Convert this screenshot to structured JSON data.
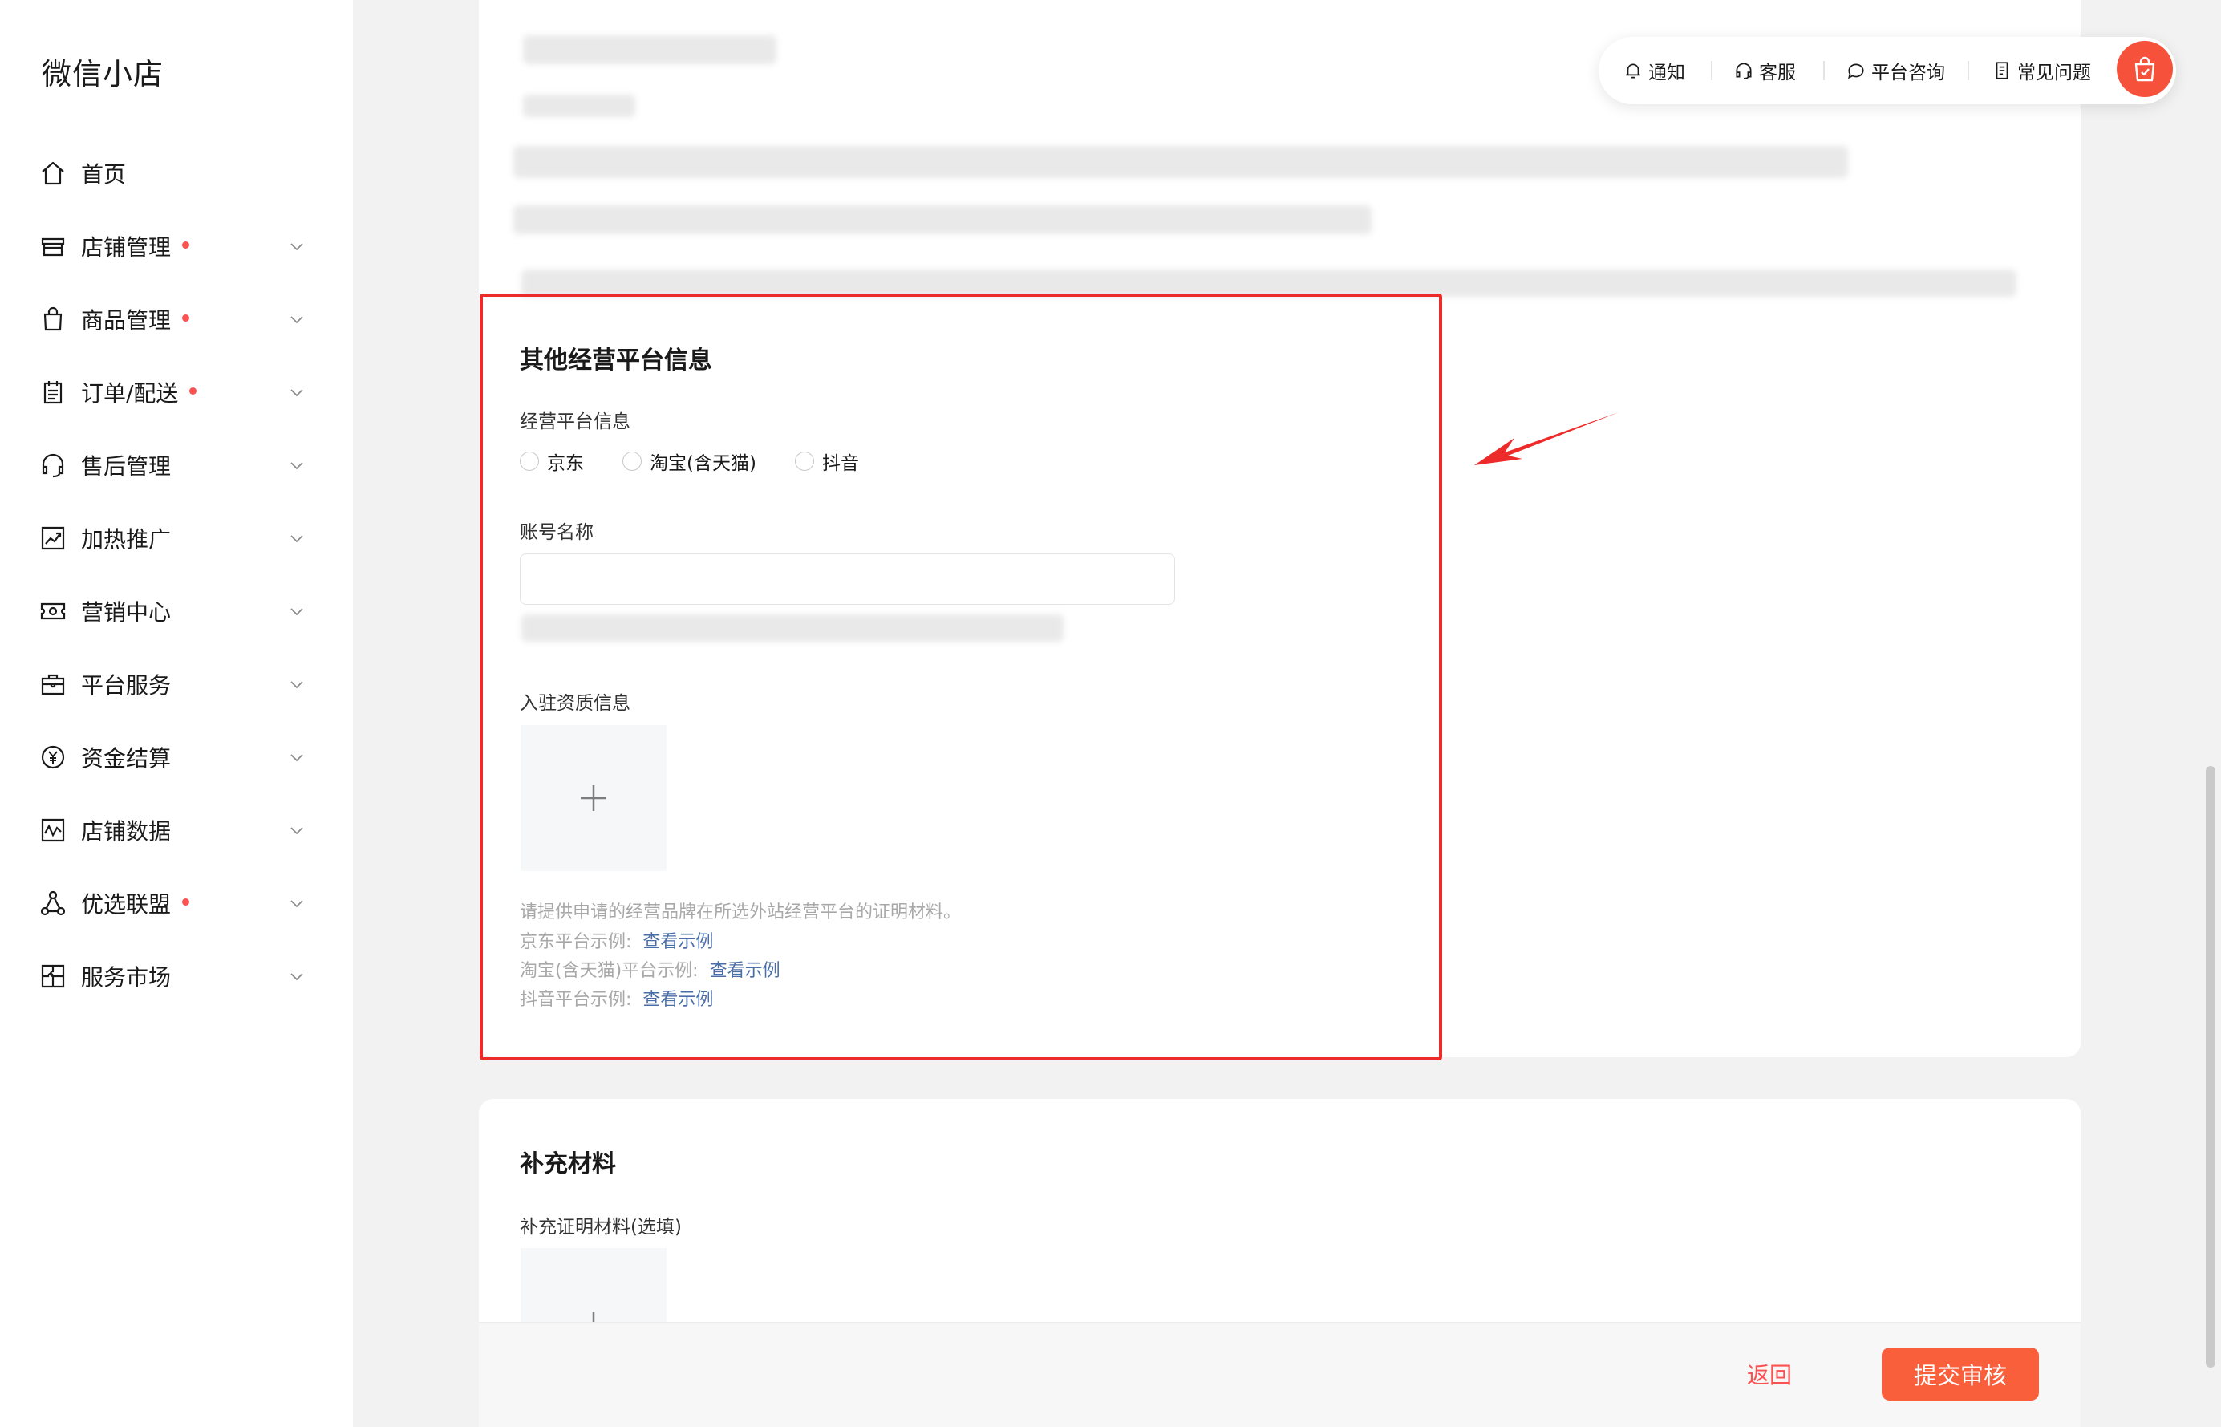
{
  "app": {
    "title": "微信小店"
  },
  "sidebar": {
    "items": [
      {
        "label": "首页",
        "icon": "home-icon",
        "dot": false,
        "chevron": false
      },
      {
        "label": "店铺管理",
        "icon": "store-icon",
        "dot": true,
        "chevron": true
      },
      {
        "label": "商品管理",
        "icon": "shopping-bag-icon",
        "dot": true,
        "chevron": true
      },
      {
        "label": "订单/配送",
        "icon": "order-clipboard-icon",
        "dot": true,
        "chevron": true
      },
      {
        "label": "售后管理",
        "icon": "headset-icon",
        "dot": false,
        "chevron": true
      },
      {
        "label": "加热推广",
        "icon": "trend-chart-icon",
        "dot": false,
        "chevron": true
      },
      {
        "label": "营销中心",
        "icon": "coupon-icon",
        "dot": false,
        "chevron": true
      },
      {
        "label": "平台服务",
        "icon": "briefcase-icon",
        "dot": false,
        "chevron": true
      },
      {
        "label": "资金结算",
        "icon": "yuan-coin-icon",
        "dot": false,
        "chevron": true
      },
      {
        "label": "店铺数据",
        "icon": "data-chart-icon",
        "dot": false,
        "chevron": true
      },
      {
        "label": "优选联盟",
        "icon": "network-icon",
        "dot": true,
        "chevron": true
      },
      {
        "label": "服务市场",
        "icon": "puzzle-icon",
        "dot": false,
        "chevron": true
      }
    ]
  },
  "toolbar": {
    "notify": "通知",
    "service": "客服",
    "consult": "平台咨询",
    "faq": "常见问题"
  },
  "other_platform": {
    "title": "其他经营平台信息",
    "platform_label": "经营平台信息",
    "options": [
      "京东",
      "淘宝(含天猫)",
      "抖音"
    ],
    "account_label": "账号名称",
    "account_value": "",
    "qualification_label": "入驻资质信息",
    "hint": "请提供申请的经营品牌在所选外站经营平台的证明材料。",
    "examples": [
      {
        "label": "京东平台示例:",
        "link": "查看示例"
      },
      {
        "label": "淘宝(含天猫)平台示例:",
        "link": "查看示例"
      },
      {
        "label": "抖音平台示例:",
        "link": "查看示例"
      }
    ]
  },
  "supplement": {
    "title": "补充材料",
    "label": "补充证明材料(选填)"
  },
  "footer": {
    "back": "返回",
    "submit": "提交审核"
  },
  "colors": {
    "accent": "#fa5f3c",
    "dot": "#fa5151",
    "highlight": "#ee2b2b",
    "link": "#4a6ea8"
  }
}
